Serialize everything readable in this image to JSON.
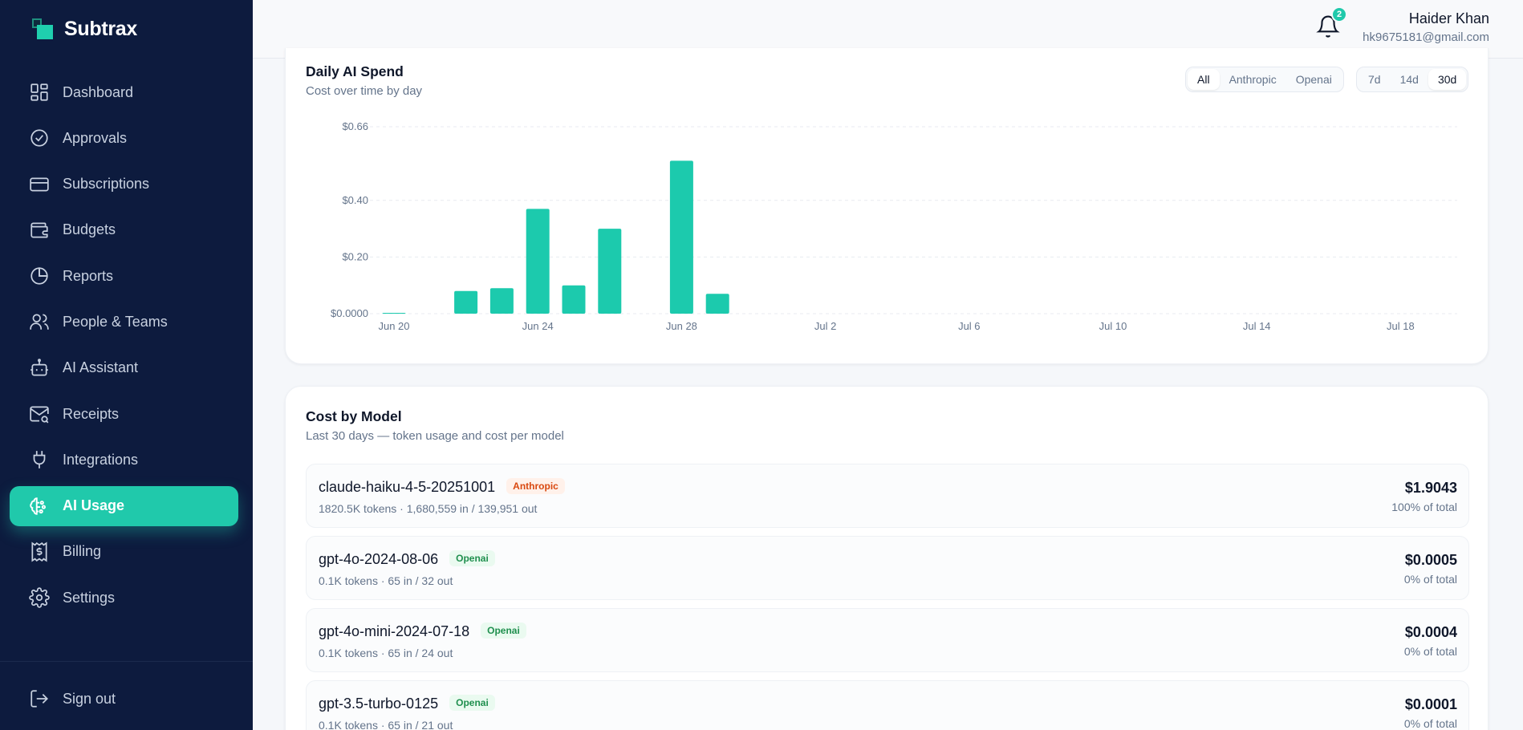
{
  "app": {
    "name": "Subtrax"
  },
  "sidebar": {
    "items": [
      {
        "label": "Dashboard",
        "icon": "dashboard-icon"
      },
      {
        "label": "Approvals",
        "icon": "check-circle-icon"
      },
      {
        "label": "Subscriptions",
        "icon": "credit-card-icon"
      },
      {
        "label": "Budgets",
        "icon": "wallet-icon"
      },
      {
        "label": "Reports",
        "icon": "pie-chart-icon"
      },
      {
        "label": "People & Teams",
        "icon": "users-icon"
      },
      {
        "label": "AI Assistant",
        "icon": "bot-icon"
      },
      {
        "label": "Receipts",
        "icon": "mail-search-icon"
      },
      {
        "label": "Integrations",
        "icon": "plug-icon"
      },
      {
        "label": "AI Usage",
        "icon": "brain-icon",
        "active": true
      },
      {
        "label": "Billing",
        "icon": "receipt-dollar-icon"
      },
      {
        "label": "Settings",
        "icon": "gear-icon"
      }
    ],
    "signout": {
      "label": "Sign out",
      "icon": "logout-icon"
    }
  },
  "header": {
    "notifications_count": "2",
    "user_name": "Haider Khan",
    "user_email": "hk9675181@gmail.com"
  },
  "spend": {
    "title": "Daily AI Spend",
    "subtitle": "Cost over time by day",
    "provider_filter": [
      "All",
      "Anthropic",
      "Openai"
    ],
    "provider_selected": "All",
    "range_filter": [
      "7d",
      "14d",
      "30d"
    ],
    "range_selected": "30d"
  },
  "chart_data": {
    "type": "bar",
    "color": "#1ccaad",
    "x_tick_labels": [
      "Jun 20",
      "Jun 24",
      "Jun 28",
      "Jul 2",
      "Jul 6",
      "Jul 10",
      "Jul 14",
      "Jul 18"
    ],
    "y_tick_labels": [
      "$0.0000",
      "$0.20",
      "$0.40",
      "$0.66"
    ],
    "y_ticks": [
      0,
      0.2,
      0.4,
      0.66
    ],
    "ylim": [
      0,
      0.66
    ],
    "categories": [
      "Jun 20",
      "Jun 21",
      "Jun 22",
      "Jun 23",
      "Jun 24",
      "Jun 25",
      "Jun 26",
      "Jun 27",
      "Jun 28",
      "Jun 29",
      "Jun 30",
      "Jul 1",
      "Jul 2",
      "Jul 3",
      "Jul 4",
      "Jul 5",
      "Jul 6",
      "Jul 7",
      "Jul 8",
      "Jul 9",
      "Jul 10",
      "Jul 11",
      "Jul 12",
      "Jul 13",
      "Jul 14",
      "Jul 15",
      "Jul 16",
      "Jul 17",
      "Jul 18",
      "Jul 19"
    ],
    "values": [
      0.002,
      0,
      0.08,
      0.09,
      0.37,
      0.1,
      0.3,
      0,
      0.54,
      0.07,
      0,
      0,
      0,
      0,
      0,
      0,
      0,
      0,
      0,
      0,
      0,
      0,
      0,
      0,
      0,
      0,
      0,
      0,
      0,
      0
    ],
    "grid": true,
    "legend": "none"
  },
  "models": {
    "title": "Cost by Model",
    "subtitle": "Last 30 days — token usage and cost per model",
    "rows": [
      {
        "name": "claude-haiku-4-5-20251001",
        "provider": "Anthropic",
        "meta": "1820.5K tokens  · 1,680,559 in / 139,951 out",
        "cost": "$1.9043",
        "pct": "100% of total"
      },
      {
        "name": "gpt-4o-2024-08-06",
        "provider": "Openai",
        "meta": "0.1K tokens  · 65 in / 32 out",
        "cost": "$0.0005",
        "pct": "0% of total"
      },
      {
        "name": "gpt-4o-mini-2024-07-18",
        "provider": "Openai",
        "meta": "0.1K tokens  · 65 in / 24 out",
        "cost": "$0.0004",
        "pct": "0% of total"
      },
      {
        "name": "gpt-3.5-turbo-0125",
        "provider": "Openai",
        "meta": "0.1K tokens  · 65 in / 21 out",
        "cost": "$0.0001",
        "pct": "0% of total"
      }
    ]
  }
}
